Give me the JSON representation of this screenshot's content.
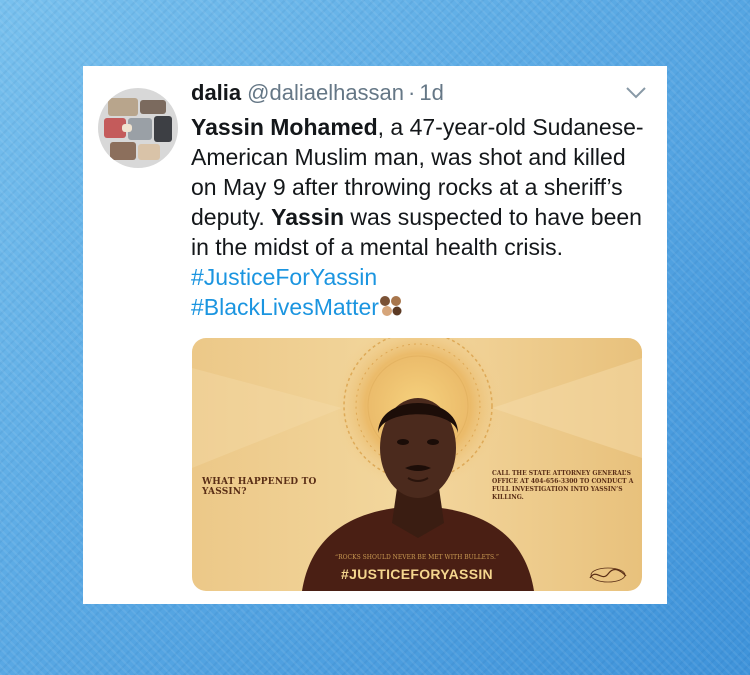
{
  "tweet": {
    "display_name": "dalia",
    "handle": "@daliaelhassan",
    "separator": "·",
    "time": "1d",
    "text": {
      "name_bold": "Yassin Mohamed",
      "part1": ", a 47-year-old Sudanese-American Muslim man, was shot and killed on May 9 after throwing rocks at a sheriff’s deputy. ",
      "name_bold_2": "Yassin",
      "part2": " was suspected to have been in the midst of a mental health crisis. ",
      "hashtag1": "#JusticeForYassin",
      "hashtag2": "#BlackLivesMatter"
    },
    "icons": {
      "menu": "chevron-down-icon",
      "emoji": "raised-fists-skin-tones-emoji"
    },
    "media": {
      "left_text": "WHAT HAPPENED TO YASSIN?",
      "right_text": "CALL THE STATE ATTORNEY GENERAL’S OFFICE AT 404-656-3300 TO CONDUCT A FULL INVESTIGATION INTO YASSIN’S KILLING.",
      "quote": "“ROCKS SHOULD NEVER BE MET WITH BULLETS.”",
      "hashtag": "#JUSTICEFORYASSIN"
    }
  },
  "colors": {
    "background": "#5aa9e4",
    "card": "#ffffff",
    "text": "#14171a",
    "muted": "#657786",
    "link": "#1b95e0",
    "poster": "#f2d49a",
    "poster_text": "#5a2e16"
  }
}
